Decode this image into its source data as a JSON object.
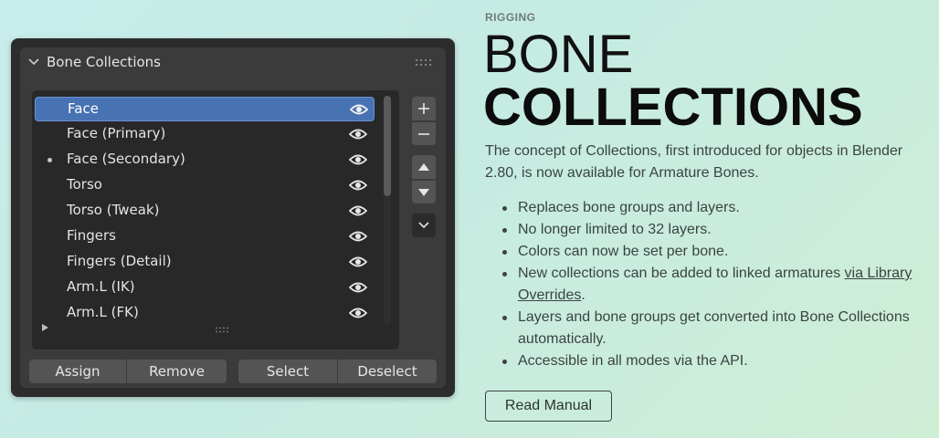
{
  "panel": {
    "header_title": "Bone Collections",
    "collections": [
      {
        "label": "Face",
        "active": true,
        "dot": false,
        "visible_icon": "eye-icon"
      },
      {
        "label": "Face (Primary)",
        "active": false,
        "dot": false,
        "visible_icon": "eye-icon"
      },
      {
        "label": "Face (Secondary)",
        "active": false,
        "dot": true,
        "visible_icon": "eye-icon"
      },
      {
        "label": "Torso",
        "active": false,
        "dot": false,
        "visible_icon": "eye-icon"
      },
      {
        "label": "Torso (Tweak)",
        "active": false,
        "dot": false,
        "visible_icon": "eye-icon"
      },
      {
        "label": "Fingers",
        "active": false,
        "dot": false,
        "visible_icon": "eye-icon"
      },
      {
        "label": "Fingers (Detail)",
        "active": false,
        "dot": false,
        "visible_icon": "eye-icon"
      },
      {
        "label": "Arm.L (IK)",
        "active": false,
        "dot": false,
        "visible_icon": "eye-icon"
      },
      {
        "label": "Arm.L (FK)",
        "active": false,
        "dot": false,
        "visible_icon": "eye-icon"
      }
    ],
    "side_icons": [
      "plus-icon",
      "minus-icon",
      "move-up-icon",
      "move-down-icon",
      "chevron-down-icon"
    ],
    "buttons": {
      "assign": "Assign",
      "remove": "Remove",
      "select": "Select",
      "deselect": "Deselect"
    }
  },
  "article": {
    "category": "RIGGING",
    "title_line1": "BONE",
    "title_line2": "COLLECTIONS",
    "intro": "The concept of Collections, first introduced for objects in Blender 2.80, is now available for Armature Bones.",
    "bullets": [
      "Replaces bone groups and layers.",
      "No longer limited to 32 layers.",
      "Colors can now be set per bone.",
      "New collections can be added to linked armatures ",
      "Layers and bone groups get converted into Bone Collections automatically.",
      "Accessible in all modes via the API."
    ],
    "bullet4_link": "via Library Overrides",
    "bullet4_suffix": ".",
    "manual_button": "Read Manual"
  },
  "colors": {
    "active_row": "#4772b3",
    "panel_bg": "#2c2c2c",
    "list_bg": "#282828"
  }
}
